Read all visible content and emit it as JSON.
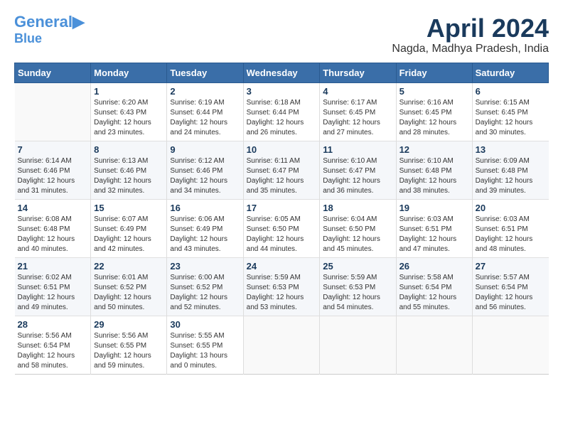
{
  "header": {
    "logo_line1": "General",
    "logo_line2": "Blue",
    "month": "April 2024",
    "location": "Nagda, Madhya Pradesh, India"
  },
  "days_of_week": [
    "Sunday",
    "Monday",
    "Tuesday",
    "Wednesday",
    "Thursday",
    "Friday",
    "Saturday"
  ],
  "weeks": [
    [
      {
        "day": "",
        "sunrise": "",
        "sunset": "",
        "daylight": ""
      },
      {
        "day": "1",
        "sunrise": "Sunrise: 6:20 AM",
        "sunset": "Sunset: 6:43 PM",
        "daylight": "Daylight: 12 hours and 23 minutes."
      },
      {
        "day": "2",
        "sunrise": "Sunrise: 6:19 AM",
        "sunset": "Sunset: 6:44 PM",
        "daylight": "Daylight: 12 hours and 24 minutes."
      },
      {
        "day": "3",
        "sunrise": "Sunrise: 6:18 AM",
        "sunset": "Sunset: 6:44 PM",
        "daylight": "Daylight: 12 hours and 26 minutes."
      },
      {
        "day": "4",
        "sunrise": "Sunrise: 6:17 AM",
        "sunset": "Sunset: 6:45 PM",
        "daylight": "Daylight: 12 hours and 27 minutes."
      },
      {
        "day": "5",
        "sunrise": "Sunrise: 6:16 AM",
        "sunset": "Sunset: 6:45 PM",
        "daylight": "Daylight: 12 hours and 28 minutes."
      },
      {
        "day": "6",
        "sunrise": "Sunrise: 6:15 AM",
        "sunset": "Sunset: 6:45 PM",
        "daylight": "Daylight: 12 hours and 30 minutes."
      }
    ],
    [
      {
        "day": "7",
        "sunrise": "Sunrise: 6:14 AM",
        "sunset": "Sunset: 6:46 PM",
        "daylight": "Daylight: 12 hours and 31 minutes."
      },
      {
        "day": "8",
        "sunrise": "Sunrise: 6:13 AM",
        "sunset": "Sunset: 6:46 PM",
        "daylight": "Daylight: 12 hours and 32 minutes."
      },
      {
        "day": "9",
        "sunrise": "Sunrise: 6:12 AM",
        "sunset": "Sunset: 6:46 PM",
        "daylight": "Daylight: 12 hours and 34 minutes."
      },
      {
        "day": "10",
        "sunrise": "Sunrise: 6:11 AM",
        "sunset": "Sunset: 6:47 PM",
        "daylight": "Daylight: 12 hours and 35 minutes."
      },
      {
        "day": "11",
        "sunrise": "Sunrise: 6:10 AM",
        "sunset": "Sunset: 6:47 PM",
        "daylight": "Daylight: 12 hours and 36 minutes."
      },
      {
        "day": "12",
        "sunrise": "Sunrise: 6:10 AM",
        "sunset": "Sunset: 6:48 PM",
        "daylight": "Daylight: 12 hours and 38 minutes."
      },
      {
        "day": "13",
        "sunrise": "Sunrise: 6:09 AM",
        "sunset": "Sunset: 6:48 PM",
        "daylight": "Daylight: 12 hours and 39 minutes."
      }
    ],
    [
      {
        "day": "14",
        "sunrise": "Sunrise: 6:08 AM",
        "sunset": "Sunset: 6:48 PM",
        "daylight": "Daylight: 12 hours and 40 minutes."
      },
      {
        "day": "15",
        "sunrise": "Sunrise: 6:07 AM",
        "sunset": "Sunset: 6:49 PM",
        "daylight": "Daylight: 12 hours and 42 minutes."
      },
      {
        "day": "16",
        "sunrise": "Sunrise: 6:06 AM",
        "sunset": "Sunset: 6:49 PM",
        "daylight": "Daylight: 12 hours and 43 minutes."
      },
      {
        "day": "17",
        "sunrise": "Sunrise: 6:05 AM",
        "sunset": "Sunset: 6:50 PM",
        "daylight": "Daylight: 12 hours and 44 minutes."
      },
      {
        "day": "18",
        "sunrise": "Sunrise: 6:04 AM",
        "sunset": "Sunset: 6:50 PM",
        "daylight": "Daylight: 12 hours and 45 minutes."
      },
      {
        "day": "19",
        "sunrise": "Sunrise: 6:03 AM",
        "sunset": "Sunset: 6:51 PM",
        "daylight": "Daylight: 12 hours and 47 minutes."
      },
      {
        "day": "20",
        "sunrise": "Sunrise: 6:03 AM",
        "sunset": "Sunset: 6:51 PM",
        "daylight": "Daylight: 12 hours and 48 minutes."
      }
    ],
    [
      {
        "day": "21",
        "sunrise": "Sunrise: 6:02 AM",
        "sunset": "Sunset: 6:51 PM",
        "daylight": "Daylight: 12 hours and 49 minutes."
      },
      {
        "day": "22",
        "sunrise": "Sunrise: 6:01 AM",
        "sunset": "Sunset: 6:52 PM",
        "daylight": "Daylight: 12 hours and 50 minutes."
      },
      {
        "day": "23",
        "sunrise": "Sunrise: 6:00 AM",
        "sunset": "Sunset: 6:52 PM",
        "daylight": "Daylight: 12 hours and 52 minutes."
      },
      {
        "day": "24",
        "sunrise": "Sunrise: 5:59 AM",
        "sunset": "Sunset: 6:53 PM",
        "daylight": "Daylight: 12 hours and 53 minutes."
      },
      {
        "day": "25",
        "sunrise": "Sunrise: 5:59 AM",
        "sunset": "Sunset: 6:53 PM",
        "daylight": "Daylight: 12 hours and 54 minutes."
      },
      {
        "day": "26",
        "sunrise": "Sunrise: 5:58 AM",
        "sunset": "Sunset: 6:54 PM",
        "daylight": "Daylight: 12 hours and 55 minutes."
      },
      {
        "day": "27",
        "sunrise": "Sunrise: 5:57 AM",
        "sunset": "Sunset: 6:54 PM",
        "daylight": "Daylight: 12 hours and 56 minutes."
      }
    ],
    [
      {
        "day": "28",
        "sunrise": "Sunrise: 5:56 AM",
        "sunset": "Sunset: 6:54 PM",
        "daylight": "Daylight: 12 hours and 58 minutes."
      },
      {
        "day": "29",
        "sunrise": "Sunrise: 5:56 AM",
        "sunset": "Sunset: 6:55 PM",
        "daylight": "Daylight: 12 hours and 59 minutes."
      },
      {
        "day": "30",
        "sunrise": "Sunrise: 5:55 AM",
        "sunset": "Sunset: 6:55 PM",
        "daylight": "Daylight: 13 hours and 0 minutes."
      },
      {
        "day": "",
        "sunrise": "",
        "sunset": "",
        "daylight": ""
      },
      {
        "day": "",
        "sunrise": "",
        "sunset": "",
        "daylight": ""
      },
      {
        "day": "",
        "sunrise": "",
        "sunset": "",
        "daylight": ""
      },
      {
        "day": "",
        "sunrise": "",
        "sunset": "",
        "daylight": ""
      }
    ]
  ]
}
